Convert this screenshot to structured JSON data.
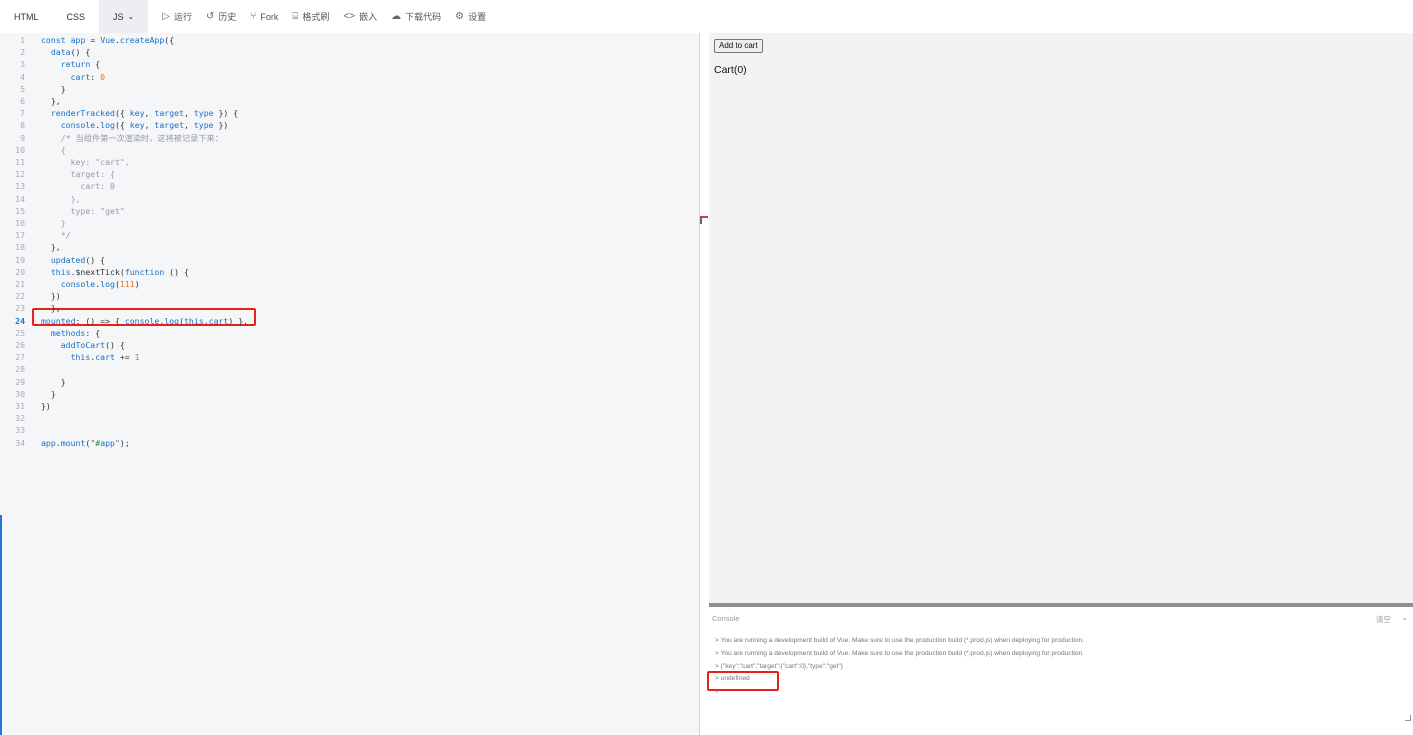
{
  "toolbar": {
    "tabs": [
      "HTML",
      "CSS",
      "JS"
    ],
    "tools": [
      {
        "icon": "play-icon",
        "glyph": "▷",
        "label": "运行"
      },
      {
        "icon": "history-icon",
        "glyph": "↺",
        "label": "历史"
      },
      {
        "icon": "fork-icon",
        "glyph": "⑂",
        "label": "Fork"
      },
      {
        "icon": "format-icon",
        "glyph": "⌸",
        "label": "格式刷"
      },
      {
        "icon": "embed-icon",
        "glyph": "<>",
        "label": "嵌入"
      },
      {
        "icon": "download-icon",
        "glyph": "☁",
        "label": "下载代码"
      },
      {
        "icon": "settings-icon",
        "glyph": "⚙",
        "label": "设置"
      }
    ]
  },
  "editor": {
    "current_line": 24,
    "lines": [
      "const app = Vue.createApp({",
      "  data() {",
      "    return {",
      "      cart: 0",
      "    }",
      "  },",
      "  renderTracked({ key, target, type }) {",
      "    console.log({ key, target, type })",
      "    /* 当组件第一次渲染时，这将被记录下来：",
      "    {",
      "      key: \"cart\",",
      "      target: {",
      "        cart: 0",
      "      },",
      "      type: \"get\"",
      "    }",
      "    */",
      "  },",
      "  updated() {",
      "  this.$nextTick(function () {",
      "    console.log(111)",
      "  })",
      "  },",
      "mounted: () => { console.log(this.cart) },",
      "  methods: {",
      "    addToCart() {",
      "      this.cart += 1",
      "",
      "    }",
      "  }",
      "})",
      "",
      "",
      "app.mount(\"#app\");"
    ]
  },
  "preview": {
    "button_label": "Add to cart",
    "cart_text": "Cart(0)"
  },
  "console": {
    "title": "Console",
    "clear_label": "清空",
    "logs": [
      "> You are running a development build of Vue. Make sure to use the production build (*.prod.js) when deploying for production.",
      "> You are running a development build of Vue. Make sure to use the production build (*.prod.js) when deploying for production.",
      "> {\"key\":\"cart\",\"target\":{\"cart\":0},\"type\":\"get\"}",
      "> undefined",
      ">"
    ]
  },
  "colors": {
    "highlight": "#e8221b",
    "keyword": "#1a6fc9",
    "string": "#2e8b57",
    "number": "#e2781b"
  }
}
